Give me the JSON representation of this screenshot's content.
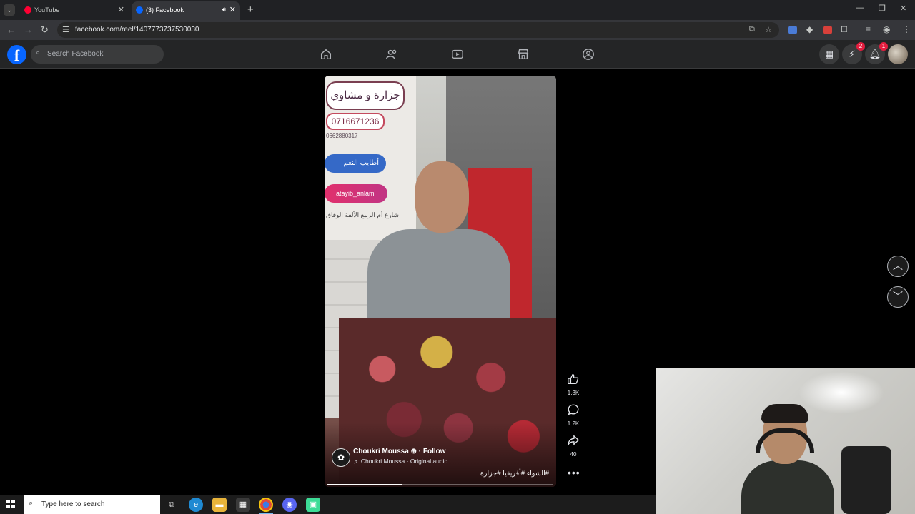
{
  "browser": {
    "tabs": [
      {
        "title": "YouTube",
        "favicon": "youtube-icon",
        "active": false
      },
      {
        "title": "(3) Facebook",
        "favicon": "facebook-icon",
        "active": true,
        "audio": true
      }
    ],
    "url": "facebook.com/reel/1407773737530030"
  },
  "facebook": {
    "logo": "f",
    "search_placeholder": "Search Facebook",
    "nav_icons": [
      "home-icon",
      "friends-icon",
      "video-icon",
      "marketplace-icon",
      "groups-icon"
    ],
    "messenger_badge": "2",
    "notifications_badge": "1"
  },
  "reel": {
    "sign_text_1": "جزارة و مشاوي أط",
    "sign_phone_1": "0716671236",
    "sign_phone_2": "0662880317",
    "sign_fb": "أطايب النعم",
    "sign_ig": "atayib_anlam",
    "sign_addr": "شارع أم الربيع الألفة الوفاق",
    "author": "Choukri Moussa",
    "follow": "· Follow",
    "audio": "♬ Choukri Moussa · Original audio",
    "hashtags": "#الشواء #أفريقيا #جزارة",
    "progress": 0.33,
    "likes": "1.3K",
    "comments": "1.2K",
    "shares": "40"
  },
  "taskbar": {
    "search_placeholder": "Type here to search"
  },
  "colors": {
    "facebook_blue": "#0866ff",
    "badge_red": "#e41e3f",
    "background": "#000000"
  }
}
